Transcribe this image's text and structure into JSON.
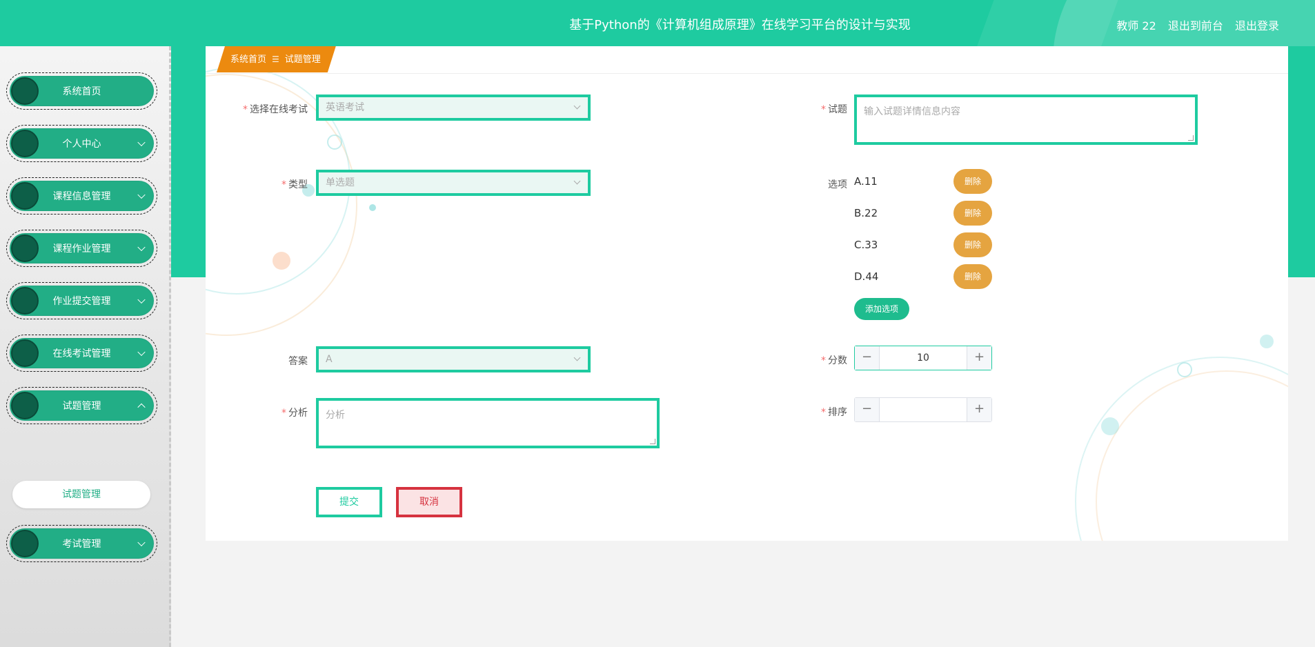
{
  "header": {
    "title": "基于Python的《计算机组成原理》在线学习平台的设计与实现",
    "user_label": "教师 22",
    "to_front_label": "退出到前台",
    "logout_label": "退出登录"
  },
  "sidebar": {
    "items": [
      {
        "label": "系统首页",
        "expanded": null
      },
      {
        "label": "个人中心",
        "expanded": false
      },
      {
        "label": "课程信息管理",
        "expanded": false
      },
      {
        "label": "课程作业管理",
        "expanded": false
      },
      {
        "label": "作业提交管理",
        "expanded": false
      },
      {
        "label": "在线考试管理",
        "expanded": false
      },
      {
        "label": "试题管理",
        "expanded": true
      },
      {
        "label": "考试管理",
        "expanded": false
      }
    ],
    "sub_item": "试题管理"
  },
  "breadcrumb": {
    "home": "系统首页",
    "separator": "☰",
    "current": "试题管理"
  },
  "form": {
    "exam": {
      "label": "选择在线考试",
      "value": "英语考试"
    },
    "question": {
      "label": "试题",
      "placeholder": "输入试题详情信息内容"
    },
    "type": {
      "label": "类型",
      "value": "单选题"
    },
    "options": {
      "label": "选项",
      "items": [
        "A.11",
        "B.22",
        "C.33",
        "D.44"
      ],
      "delete_label": "删除",
      "add_label": "添加选项"
    },
    "answer": {
      "label": "答案",
      "value": "A"
    },
    "score": {
      "label": "分数",
      "value": "10"
    },
    "analysis": {
      "label": "分析",
      "placeholder": "分析"
    },
    "order": {
      "label": "排序",
      "value": ""
    },
    "submit_label": "提交",
    "cancel_label": "取消"
  },
  "colors": {
    "primary": "#1ecba0",
    "sidebar_pill": "#22ae86",
    "breadcrumb": "#ec8a0f",
    "delete": "#e5a440",
    "cancel": "#d6323f"
  },
  "icons": {
    "minus": "−",
    "plus": "+"
  }
}
